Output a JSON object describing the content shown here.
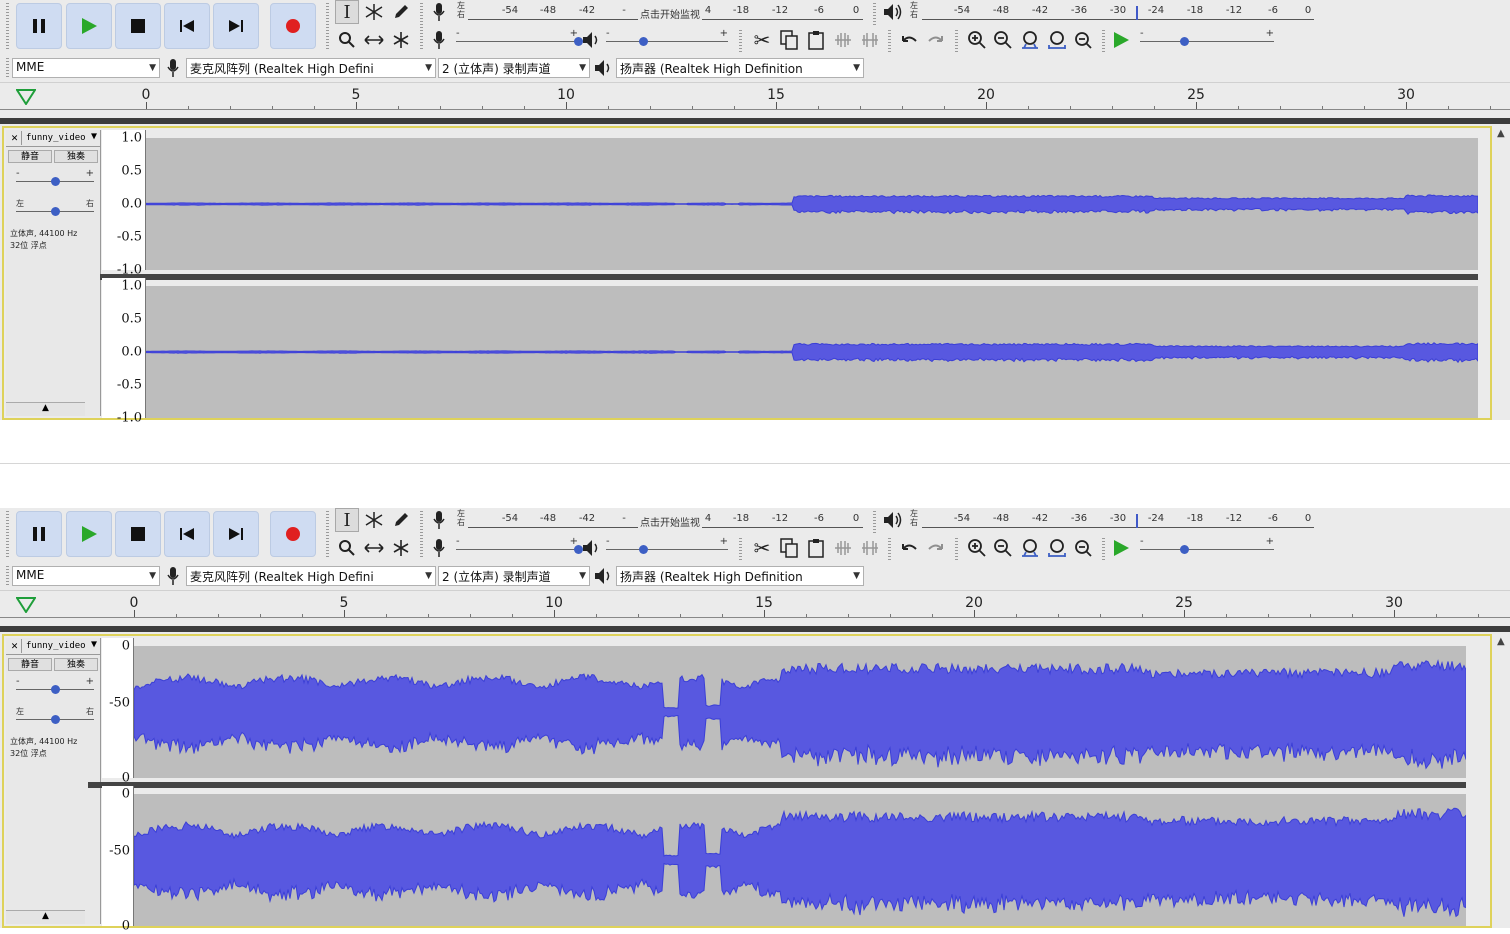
{
  "transport": {
    "pause_icon": "pause-icon",
    "play_icon": "play-icon",
    "stop_icon": "stop-icon",
    "skip_start_icon": "skip-to-start-icon",
    "skip_end_icon": "skip-to-end-icon",
    "record_icon": "record-icon",
    "accent": "#cfdcf2",
    "record_color": "#e02020",
    "play_color": "#2aa82a"
  },
  "recording_meter": {
    "ticks": [
      "-54",
      "-48",
      "-42",
      "-",
      "4",
      "-18",
      "-12",
      "-6",
      "0"
    ],
    "message": "点击开始监视",
    "lr": [
      "左",
      "右"
    ]
  },
  "playback_meter": {
    "ticks": [
      "-54",
      "-48",
      "-42",
      "-36",
      "-30",
      "-24",
      "-18",
      "-12",
      "-6",
      "0"
    ],
    "lr": [
      "左",
      "右"
    ]
  },
  "sliders": {
    "minus": "-",
    "plus": "+",
    "record_volume": 1.0,
    "playback_volume": 0.3,
    "play_speed": 0.33
  },
  "devices": {
    "host": "MME",
    "mic": "麦克风阵列 (Realtek High Defini",
    "channels": "2 (立体声) 录制声道",
    "speaker": "扬声器 (Realtek High Definition"
  },
  "timeline": {
    "labels": [
      "0",
      "5",
      "10",
      "15",
      "20",
      "25",
      "30"
    ]
  },
  "track": {
    "name": "funny_video",
    "close": "✕",
    "mute": "静音",
    "solo": "独奏",
    "pan_left": "左",
    "pan_right": "右",
    "info_line1": "立体声, 44100 Hz",
    "info_line2": "32位 浮点",
    "collapse": "▲"
  },
  "panels": [
    {
      "scale": "linear",
      "ticks": [
        "1.0",
        "0.5",
        "0.0",
        "-0.5",
        "-1.0"
      ]
    },
    {
      "scale": "db",
      "ticks": [
        "0",
        "-50",
        "0"
      ]
    }
  ],
  "colors": {
    "waveform": "#3b3fd6",
    "waveform_fill": "#5858e0",
    "track_bg": "#bdbdbd",
    "selected_border": "#ded25a"
  }
}
